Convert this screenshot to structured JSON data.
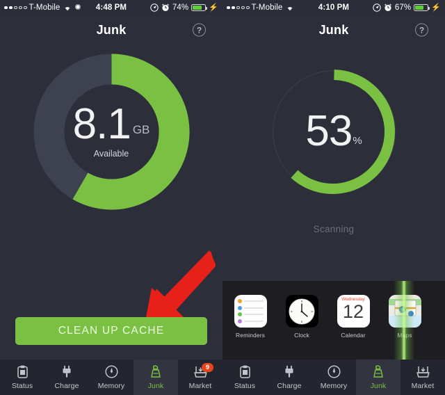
{
  "colors": {
    "background": "#2c2e3a",
    "accent_green": "#7ac143",
    "track_gray": "#3e4150",
    "arrow_red": "#e8201a",
    "badge_orange": "#e8441d",
    "tabbar_bg": "#24262f"
  },
  "panels": [
    {
      "statusbar": {
        "carrier": "T-Mobile",
        "wifi_icon": "wifi-icon",
        "snowflake_icon": "snowflake-icon",
        "time": "4:48 PM",
        "location_icon": "location-icon",
        "alarm_icon": "alarm-icon",
        "battery_percent": "74%",
        "battery_level": 74,
        "charging_icon": "lightning-bolt-icon"
      },
      "header": {
        "title": "Junk",
        "help_icon": "question-mark-icon"
      },
      "donut": {
        "type": "available-storage",
        "value": "8.1",
        "unit": "GB",
        "sublabel": "Available",
        "arc_percent": 68,
        "has_track": true
      },
      "primary_button": {
        "label": "CLEAN UP CACHE"
      },
      "annotation": {
        "arrow_icon": "red-arrow-icon",
        "points_to": "CLEAN UP CACHE"
      },
      "tabs": [
        {
          "label": "Status",
          "icon": "clipboard-icon",
          "active": false,
          "badge": null
        },
        {
          "label": "Charge",
          "icon": "plug-icon",
          "active": false,
          "badge": null
        },
        {
          "label": "Memory",
          "icon": "gauge-icon",
          "active": false,
          "badge": null
        },
        {
          "label": "Junk",
          "icon": "broom-icon",
          "active": true,
          "badge": null
        },
        {
          "label": "Market",
          "icon": "download-tray-icon",
          "active": false,
          "badge": "9"
        }
      ]
    },
    {
      "statusbar": {
        "carrier": "T-Mobile",
        "wifi_icon": "wifi-icon",
        "snowflake_icon": null,
        "time": "4:10 PM",
        "location_icon": "location-icon",
        "alarm_icon": "alarm-icon",
        "battery_percent": "67%",
        "battery_level": 67,
        "charging_icon": "lightning-bolt-icon"
      },
      "header": {
        "title": "Junk",
        "help_icon": "question-mark-icon"
      },
      "donut": {
        "type": "scan-progress",
        "value": "53",
        "unit": "%",
        "sublabel": null,
        "arc_percent": 72,
        "has_track": false
      },
      "status_text": "Scanning",
      "apps": [
        {
          "name": "Reminders",
          "icon": "reminders-app-icon"
        },
        {
          "name": "Clock",
          "icon": "clock-app-icon"
        },
        {
          "name": "Calendar",
          "icon": "calendar-app-icon",
          "day": "Wednesday",
          "date": "12",
          "scanning": true
        },
        {
          "name": "Maps",
          "icon": "maps-app-icon"
        }
      ],
      "tabs": [
        {
          "label": "Status",
          "icon": "clipboard-icon",
          "active": false,
          "badge": null
        },
        {
          "label": "Charge",
          "icon": "plug-icon",
          "active": false,
          "badge": null
        },
        {
          "label": "Memory",
          "icon": "gauge-icon",
          "active": false,
          "badge": null
        },
        {
          "label": "Junk",
          "icon": "broom-icon",
          "active": true,
          "badge": null
        },
        {
          "label": "Market",
          "icon": "download-tray-icon",
          "active": false,
          "badge": null
        }
      ]
    }
  ]
}
